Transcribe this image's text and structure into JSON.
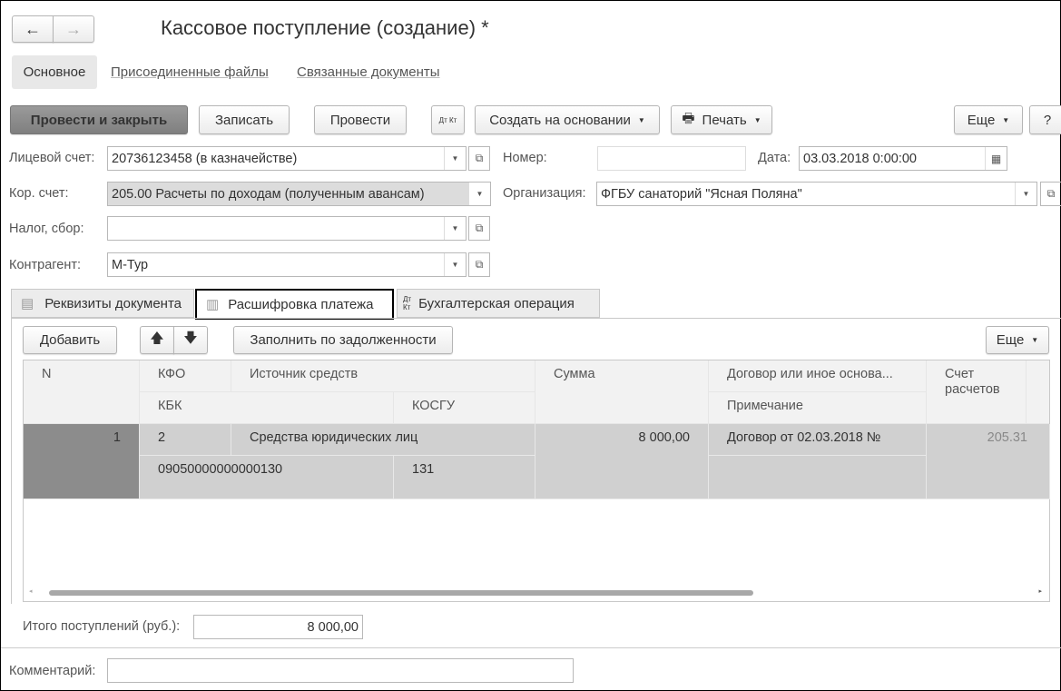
{
  "title": "Кассовое поступление (создание) *",
  "nav_tabs": [
    "Основное",
    "Присоединенные файлы",
    "Связанные документы"
  ],
  "toolbar": {
    "post_close": "Провести и закрыть",
    "save": "Записать",
    "post": "Провести",
    "dtkt": "Дт Кт",
    "create_based": "Создать на основании",
    "print": "Печать",
    "more": "Еще",
    "help": "?"
  },
  "fields": {
    "account_label": "Лицевой счет:",
    "account": "20736123458 (в казначействе)",
    "number_label": "Номер:",
    "number": "",
    "date_label": "Дата:",
    "date": "03.03.2018  0:00:00",
    "cor_label": "Кор. счет:",
    "cor": "205.00 Расчеты по доходам (полученным авансам)",
    "org_label": "Организация:",
    "org": "ФГБУ санаторий \"Ясная Поляна\"",
    "tax_label": "Налог, сбор:",
    "tax": "",
    "contractor_label": "Контрагент:",
    "contractor": "М-Тур"
  },
  "doc_tabs": [
    "Реквизиты документа",
    "Расшифровка платежа",
    "Бухгалтерская операция"
  ],
  "table_toolbar": {
    "add": "Добавить",
    "fill": "Заполнить по задолженности",
    "more": "Еще"
  },
  "table": {
    "headers": {
      "n": "N",
      "kfo": "КФО",
      "source": "Источник средств",
      "kbk": "КБК",
      "kosgu": "КОСГУ",
      "sum": "Сумма",
      "contract": "Договор или иное основа...",
      "note": "Примечание",
      "account": "Счет расчетов"
    },
    "rows": [
      {
        "n": "1",
        "kfo": "2",
        "source": "Средства юридических лиц",
        "kbk": "09050000000000130",
        "kosgu": "131",
        "sum": "8 000,00",
        "contract": "Договор от 02.03.2018 №",
        "note": "",
        "account": "205.31"
      }
    ]
  },
  "total_label": "Итого поступлений (руб.):",
  "total": "8 000,00",
  "comment_label": "Комментарий:",
  "comment": ""
}
